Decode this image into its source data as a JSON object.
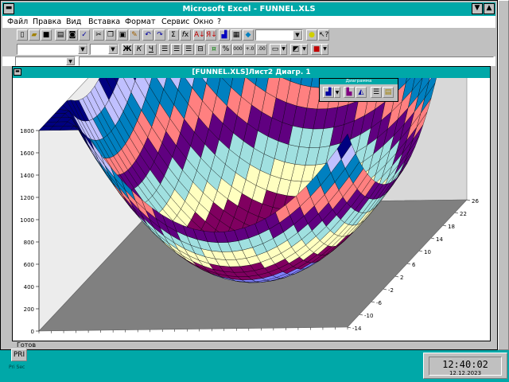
{
  "window": {
    "title": "Microsoft Excel - FUNNEL.XLS"
  },
  "menu": {
    "items": [
      "Файл",
      "Правка",
      "Вид",
      "Вставка",
      "Формат",
      "Сервис",
      "Окно",
      "?"
    ]
  },
  "chart_window": {
    "title": "[FUNNEL.XLS]Лист2 Диагр. 1"
  },
  "chart_toolbar": {
    "title": "Диаграмма"
  },
  "status": {
    "text": "Готов"
  },
  "desktop": {
    "print_label": "PRI",
    "print_caption": "Pri Sec"
  },
  "clock": {
    "time": "12:40:02",
    "date": "12.12.2023"
  },
  "chart_data": {
    "type": "surface",
    "title": "",
    "z_ticks": [
      0,
      200,
      400,
      600,
      800,
      1000,
      1200,
      1400,
      1600,
      1800
    ],
    "y_ticks": [
      -14,
      -10,
      -6,
      -2,
      2,
      6,
      10,
      14,
      18,
      22,
      26
    ],
    "z_range": [
      0,
      1800
    ],
    "bands": [
      {
        "range": [
          0,
          200
        ],
        "color": "#8080ff"
      },
      {
        "range": [
          200,
          400
        ],
        "color": "#800060"
      },
      {
        "range": [
          400,
          600
        ],
        "color": "#ffffc0"
      },
      {
        "range": [
          600,
          800
        ],
        "color": "#a0e0e0"
      },
      {
        "range": [
          800,
          1000
        ],
        "color": "#600080"
      },
      {
        "range": [
          1000,
          1200
        ],
        "color": "#ff8080"
      },
      {
        "range": [
          1200,
          1400
        ],
        "color": "#0080c0"
      },
      {
        "range": [
          1400,
          1600
        ],
        "color": "#c0c0ff"
      },
      {
        "range": [
          1600,
          1800
        ],
        "color": "#000080"
      }
    ],
    "grid": true
  }
}
